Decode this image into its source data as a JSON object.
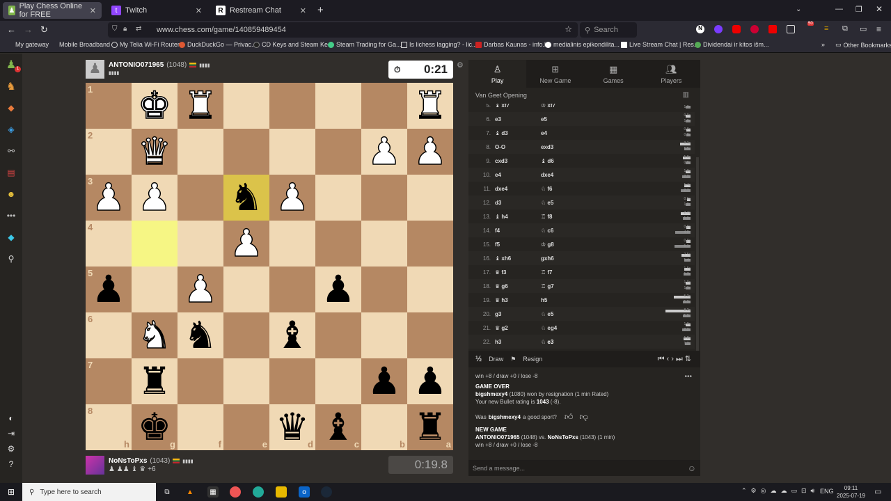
{
  "browser": {
    "tabs": [
      {
        "label": "Play Chess Online for FREE",
        "active": true
      },
      {
        "label": "Twitch",
        "active": false
      },
      {
        "label": "Restream Chat",
        "active": false
      }
    ],
    "url": "www.chess.com/game/140859489454",
    "search_placeholder": "Search",
    "bookmarks": [
      "My gateway",
      "Mobile Broadband",
      "My Telia Wi-Fi Router",
      "DuckDuckGo — Privac...",
      "CD Keys and Steam Ke...",
      "Steam Trading for Ga...",
      "Is lichess lagging? - lic...",
      "Darbas Kaunas - info.lt",
      "medialinis epikondilita...",
      "Live Stream Chat | Res...",
      "Dividendai ir kitos išm..."
    ],
    "other_bookmarks": "Other Bookmarks",
    "ext_badge": "50"
  },
  "game": {
    "top_player": {
      "name": "ANTONIO071965",
      "rating": "(1048)",
      "clock": "0:21"
    },
    "bottom_player": {
      "name": "NoNsToPxs",
      "rating": "(1043)",
      "captured_extra": "+6",
      "clock": "0:19.8"
    },
    "ranks": [
      "1",
      "2",
      "3",
      "4",
      "5",
      "6",
      "7",
      "8"
    ],
    "files": [
      "h",
      "g",
      "f",
      "e",
      "d",
      "c",
      "b",
      "a"
    ],
    "pieces": [
      {
        "sq": "g1",
        "glyph": "♚",
        "side": "w"
      },
      {
        "sq": "f1",
        "glyph": "♜",
        "side": "w"
      },
      {
        "sq": "a1",
        "glyph": "♜",
        "side": "w"
      },
      {
        "sq": "g2",
        "glyph": "♛",
        "side": "w"
      },
      {
        "sq": "b2",
        "glyph": "♟",
        "side": "w"
      },
      {
        "sq": "a2",
        "glyph": "♟",
        "side": "w"
      },
      {
        "sq": "h3",
        "glyph": "♟",
        "side": "w"
      },
      {
        "sq": "g3",
        "glyph": "♟",
        "side": "w"
      },
      {
        "sq": "e3",
        "glyph": "♞",
        "side": "b"
      },
      {
        "sq": "d3",
        "glyph": "♟",
        "side": "w"
      },
      {
        "sq": "e4",
        "glyph": "♟",
        "side": "w"
      },
      {
        "sq": "h5",
        "glyph": "♟",
        "side": "b"
      },
      {
        "sq": "f5",
        "glyph": "♟",
        "side": "w"
      },
      {
        "sq": "c5",
        "glyph": "♟",
        "side": "b"
      },
      {
        "sq": "g6",
        "glyph": "♞",
        "side": "w"
      },
      {
        "sq": "f6",
        "glyph": "♞",
        "side": "b"
      },
      {
        "sq": "d6",
        "glyph": "♝",
        "side": "b"
      },
      {
        "sq": "g7",
        "glyph": "♜",
        "side": "b"
      },
      {
        "sq": "b7",
        "glyph": "♟",
        "side": "b"
      },
      {
        "sq": "a7",
        "glyph": "♟",
        "side": "b"
      },
      {
        "sq": "g8",
        "glyph": "♚",
        "side": "b"
      },
      {
        "sq": "d8",
        "glyph": "♛",
        "side": "b"
      },
      {
        "sq": "c8",
        "glyph": "♝",
        "side": "b"
      },
      {
        "sq": "a8",
        "glyph": "♜",
        "side": "b"
      }
    ],
    "highlights": [
      {
        "sq": "g4",
        "kind": "from"
      },
      {
        "sq": "e3",
        "kind": "to"
      }
    ]
  },
  "panel": {
    "tabs": [
      {
        "label": "Play",
        "icon": "pawn-icon"
      },
      {
        "label": "New Game",
        "icon": "plus-icon"
      },
      {
        "label": "Games",
        "icon": "board-icon"
      },
      {
        "label": "Players",
        "icon": "players-icon"
      }
    ],
    "opening": "Van Geet Opening",
    "moves": [
      {
        "n": "5.",
        "w": "♝ xf7",
        "b": "♔ xf7",
        "tw": "",
        "tb": "1.0s"
      },
      {
        "n": "6.",
        "w": "e3",
        "b": "e5",
        "tw": "0.9s",
        "tb": "1.0s"
      },
      {
        "n": "7.",
        "w": "♝ d3",
        "b": "e4",
        "tw": "0.8s",
        "tb": "0.8s"
      },
      {
        "n": "8.",
        "w": "O-O",
        "b": "exd3",
        "tw": "3.1s",
        "tb": "1.5s"
      },
      {
        "n": "9.",
        "w": "cxd3",
        "b": "♝ d6",
        "tw": "1.9s",
        "tb": "0.9s"
      },
      {
        "n": "10.",
        "w": "e4",
        "b": "dxe4",
        "tw": "1.0s",
        "tb": "2.3s"
      },
      {
        "n": "11.",
        "w": "dxe4",
        "b": "♘ f6",
        "tw": "1.4s",
        "tb": "2.7s"
      },
      {
        "n": "12.",
        "w": "d3",
        "b": "♘ e5",
        "tw": "0.6s",
        "tb": "1.0s"
      },
      {
        "n": "13.",
        "w": "♝ h4",
        "b": "♖ f8",
        "tw": "2.7s",
        "tb": "1.9s"
      },
      {
        "n": "14.",
        "w": "f4",
        "b": "♘ c6",
        "tw": "0.8s",
        "tb": "4.8s"
      },
      {
        "n": "15.",
        "w": "f5",
        "b": "♔ g8",
        "tw": "0.8s",
        "tb": "5.1s"
      },
      {
        "n": "16.",
        "w": "♝ xh6",
        "b": "gxh6",
        "tw": "2.5s",
        "tb": "1.4s"
      },
      {
        "n": "17.",
        "w": "♛ f3",
        "b": "♖ f7",
        "tw": "1.5s",
        "tb": "1.7s"
      },
      {
        "n": "18.",
        "w": "♛ g6",
        "b": "♖ g7",
        "tw": "1.0s",
        "tb": "1.1s"
      },
      {
        "n": "19.",
        "w": "♛ h3",
        "b": "h5",
        "tw": "5.3s",
        "tb": "1.9s"
      },
      {
        "n": "20.",
        "w": "g3",
        "b": "♘ e5",
        "tw": "8.2s",
        "tb": "1.9s"
      },
      {
        "n": "21.",
        "w": "♛ g2",
        "b": "♘ eg4",
        "tw": "1.0s",
        "tb": "2.2s"
      },
      {
        "n": "22.",
        "w": "h3",
        "b": "♘ e3",
        "tw": "1.8s",
        "tb": "1.3s"
      }
    ],
    "draw": "Draw",
    "resign": "Resign",
    "half": "½",
    "chat": {
      "line0": "win +8 / draw +0 / lose -8",
      "game_over": "GAME OVER",
      "winner": "bigshmexy4",
      "winner_rest": "(1080) won by resignation (1 min Rated)",
      "rating_line": "Your new Bullet rating is",
      "rating_value": "1043",
      "rating_change": "(-8).",
      "sport_pre": "Was",
      "sport_name": "bigshmexy4",
      "sport_post": "a good sport?",
      "new_game": "NEW GAME",
      "ng_p1": "ANTONIO071965",
      "ng_p1r": "(1048) vs.",
      "ng_p2": "NoNsToPxs",
      "ng_p2r": "(1043) (1 min)",
      "ng_odds": "win +8 / draw +0 / lose -8"
    },
    "message_placeholder": "Send a message..."
  },
  "taskbar": {
    "search_placeholder": "Type here to search",
    "lang": "ENG",
    "time": "09:11",
    "date": "2025-07-19"
  }
}
